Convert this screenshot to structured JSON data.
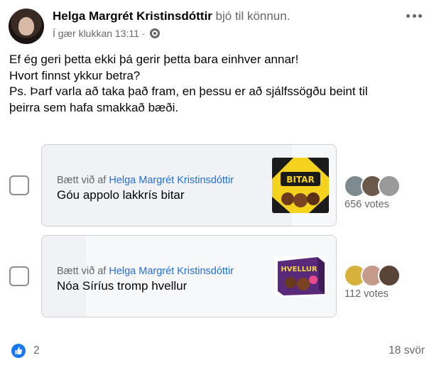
{
  "post": {
    "author": "Helga Margrét Kristinsdóttir",
    "action": " bjó til könnun.",
    "timestamp": "Í gær klukkan 13:11",
    "separator": " · ",
    "privacy_icon": "public-globe-icon",
    "text_lines": [
      "Ef ég geri þetta ekki þá gerir þetta bara einhver annar!",
      "Hvort finnst ykkur betra?",
      "Ps. Þarf varla að taka það fram, en þessu er að sjálfssögðu beint til",
      "þeirra sem hafa smakkað bæði."
    ]
  },
  "poll": {
    "options": [
      {
        "added_by_prefix": "Bætt við af ",
        "added_by_name": "Helga Margrét Kristinsdóttir",
        "label": "Góu appolo lakkrís bitar",
        "votes_text": "656 votes",
        "vote_share": 0.85,
        "thumbnail_text": "BITAR",
        "voter_avatar_colors": [
          "#7d8a8f",
          "#6b5a49",
          "#9a9a9a"
        ]
      },
      {
        "added_by_prefix": "Bætt við af ",
        "added_by_name": "Helga Margrét Kristinsdóttir",
        "label": "Nóa Síríus tromp hvellur",
        "votes_text": "112 votes",
        "vote_share": 0.15,
        "thumbnail_text": "HVELLUR",
        "voter_avatar_colors": [
          "#d6b23a",
          "#c59a8a",
          "#5a4438"
        ]
      }
    ]
  },
  "footer": {
    "reaction_icon": "like-icon",
    "reaction_count": "2",
    "comments": "18 svör"
  },
  "colors": {
    "link_blue": "#216fdb",
    "like_blue": "#1877f2",
    "secondary_text": "#65676b"
  }
}
